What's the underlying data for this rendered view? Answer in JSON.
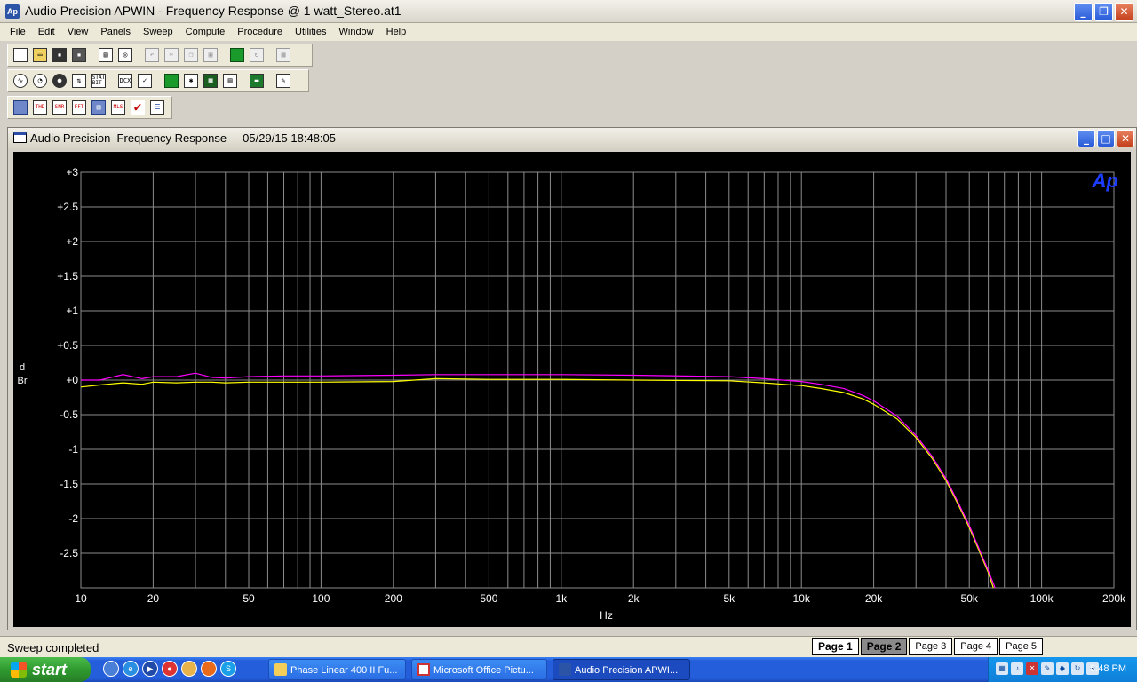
{
  "window": {
    "app_icon": "Ap",
    "title": "Audio Precision APWIN - Frequency Response @ 1 watt_Stereo.at1"
  },
  "menu": [
    "File",
    "Edit",
    "View",
    "Panels",
    "Sweep",
    "Compute",
    "Procedure",
    "Utilities",
    "Window",
    "Help"
  ],
  "toolbar_icons": {
    "row1": [
      "new-document-icon",
      "open-folder-icon",
      "save-icon",
      "save-all-icon",
      "print-icon",
      "print-preview-icon",
      "undo-icon",
      "cut-icon",
      "copy-icon",
      "paste-icon",
      "go-icon",
      "stop-icon",
      "panel-icon"
    ],
    "row2": [
      "generator-icon",
      "analyzer-icon",
      "dsp-icon",
      "switcher-icon",
      "stat-bit-icon",
      "dcx-icon",
      "bar-icon",
      "monitor-icon",
      "sweep-icon",
      "graph-icon",
      "data-table-icon",
      "load-icon",
      "compute-icon"
    ],
    "row3": [
      "graph-page-icon",
      "thd-icon",
      "snr-icon",
      "fft-icon",
      "bargraph-icon",
      "mls-icon",
      "check-icon",
      "list-icon"
    ],
    "labels": {
      "stat": "STAT BIT",
      "dcx": "DCX",
      "thd": "THD",
      "snr": "SNR",
      "fft": "FFT",
      "mls": "MLS"
    }
  },
  "child": {
    "title": "Audio Precision  Frequency Response     05/29/15 18:48:05"
  },
  "ap_logo": "Ap",
  "chart_data": {
    "type": "line",
    "xlabel": "Hz",
    "ylabel": "dBr",
    "xscale": "log",
    "xlim": [
      10,
      200000
    ],
    "ylim": [
      -3,
      3
    ],
    "grid": true,
    "y_ticks": [
      3,
      2.5,
      2,
      1.5,
      1,
      0.5,
      0,
      -0.5,
      -1,
      -1.5,
      -2,
      -2.5
    ],
    "y_tick_labels": [
      "+3",
      "+2.5",
      "+2",
      "+1.5",
      "+1",
      "+0.5",
      "+0",
      "-0.5",
      "-1",
      "-1.5",
      "-2",
      "-2.5"
    ],
    "x_ticks": [
      10,
      20,
      50,
      100,
      200,
      500,
      1000,
      2000,
      5000,
      10000,
      20000,
      50000,
      100000,
      200000
    ],
    "x_tick_labels": [
      "10",
      "20",
      "50",
      "100",
      "200",
      "500",
      "1k",
      "2k",
      "5k",
      "10k",
      "20k",
      "50k",
      "100k",
      "200k"
    ],
    "series": [
      {
        "color": "#ff00ff",
        "x": [
          10,
          12,
          15,
          18,
          20,
          25,
          30,
          35,
          40,
          50,
          70,
          100,
          200,
          300,
          500,
          1000,
          2000,
          5000,
          7000,
          10000,
          12000,
          15000,
          18000,
          20000,
          25000,
          30000,
          35000,
          40000,
          45000,
          50000,
          55000,
          60000,
          64000
        ],
        "y": [
          0,
          0,
          0.08,
          0.02,
          0.05,
          0.05,
          0.1,
          0.04,
          0.03,
          0.05,
          0.06,
          0.06,
          0.07,
          0.08,
          0.08,
          0.08,
          0.07,
          0.05,
          0.02,
          -0.02,
          -0.06,
          -0.12,
          -0.22,
          -0.3,
          -0.52,
          -0.8,
          -1.1,
          -1.42,
          -1.77,
          -2.1,
          -2.44,
          -2.75,
          -3
        ]
      },
      {
        "color": "#ffff00",
        "x": [
          10,
          12,
          15,
          18,
          20,
          25,
          30,
          35,
          40,
          50,
          70,
          100,
          200,
          300,
          500,
          1000,
          2000,
          5000,
          7000,
          10000,
          12000,
          15000,
          18000,
          20000,
          25000,
          30000,
          35000,
          40000,
          45000,
          50000,
          55000,
          60000,
          63000
        ],
        "y": [
          -0.1,
          -0.07,
          -0.04,
          -0.06,
          -0.03,
          -0.04,
          -0.03,
          -0.03,
          -0.04,
          -0.03,
          -0.03,
          -0.03,
          -0.02,
          0.02,
          0.01,
          0.01,
          0.0,
          -0.01,
          -0.04,
          -0.08,
          -0.12,
          -0.18,
          -0.27,
          -0.35,
          -0.56,
          -0.83,
          -1.13,
          -1.45,
          -1.8,
          -2.13,
          -2.47,
          -2.78,
          -3
        ]
      }
    ]
  },
  "status": {
    "message": "Sweep completed",
    "pages": [
      "Page 1",
      "Page 2",
      "Page 3",
      "Page 4",
      "Page 5"
    ]
  },
  "taskbar": {
    "start": "start",
    "tasks": [
      "Phase Linear 400 II Fu...",
      "Microsoft Office Pictu...",
      "Audio Precision APWI..."
    ],
    "clock": "6:48 PM"
  }
}
